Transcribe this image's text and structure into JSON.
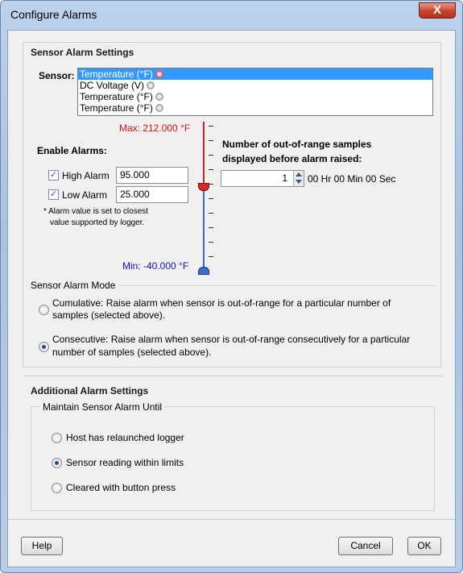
{
  "window": {
    "title": "Configure Alarms",
    "close_glyph": "X"
  },
  "sensor_section": {
    "heading": "Sensor Alarm Settings",
    "sensor_label": "Sensor:",
    "sensors": [
      {
        "label": "Temperature (°F)",
        "selected": true,
        "alarm_active": true,
        "icon": "alarm-clock-icon"
      },
      {
        "label": "DC Voltage (V)",
        "selected": false,
        "alarm_active": false,
        "icon": "alarm-clock-icon"
      },
      {
        "label": "Temperature (°F)",
        "selected": false,
        "alarm_active": false,
        "icon": "alarm-clock-icon"
      },
      {
        "label": "Temperature (°F)",
        "selected": false,
        "alarm_active": false,
        "icon": "alarm-clock-icon"
      }
    ],
    "enable_alarms_label": "Enable Alarms:",
    "high_alarm": {
      "label": "High Alarm",
      "checked": true,
      "value": "95.000"
    },
    "low_alarm": {
      "label": "Low Alarm",
      "checked": true,
      "value": "25.000"
    },
    "footnote_line1": "* Alarm value is set to closest",
    "footnote_line2": "value supported by logger.",
    "scale": {
      "max_label": "Max: 212.000 °F",
      "min_label": "Min: -40.000 °F",
      "max_color": "#e01010",
      "min_color": "#1010d0"
    },
    "samples_heading_line1": "Number of out-of-range samples",
    "samples_heading_line2": "displayed before alarm raised:",
    "samples_value": "1",
    "samples_duration": "00 Hr 00 Min 00 Sec",
    "mode_legend": "Sensor Alarm Mode",
    "mode_cumulative_line1": "Cumulative: Raise alarm when sensor is out-of-range for a particular number of",
    "mode_cumulative_line2": "samples (selected above).",
    "mode_consecutive_line1": "Consecutive: Raise alarm when sensor is out-of-range consecutively for a particular",
    "mode_consecutive_line2": "number of samples (selected above).",
    "mode_selected": "consecutive"
  },
  "additional_section": {
    "heading": "Additional Alarm Settings",
    "maintain_legend": "Maintain Sensor Alarm Until",
    "options": [
      {
        "label": "Host has relaunched logger",
        "selected": false
      },
      {
        "label": "Sensor reading within limits",
        "selected": true
      },
      {
        "label": "Cleared with button press",
        "selected": false
      }
    ]
  },
  "buttons": {
    "help": "Help",
    "cancel": "Cancel",
    "ok": "OK"
  }
}
